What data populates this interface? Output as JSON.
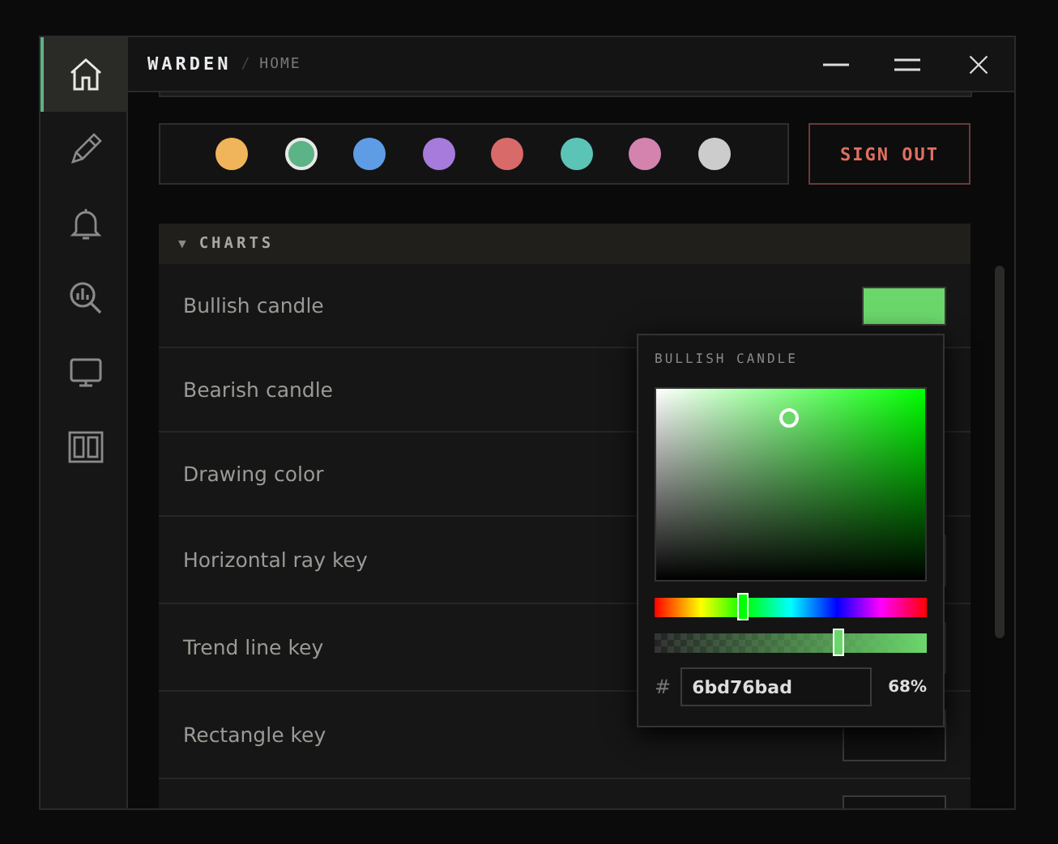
{
  "window": {
    "brand": "WARDEN",
    "separator": "/",
    "breadcrumb": "HOME"
  },
  "sidebar": {
    "items": [
      {
        "selected": true
      },
      {
        "selected": false
      },
      {
        "selected": false
      },
      {
        "selected": false
      },
      {
        "selected": false
      },
      {
        "selected": false
      }
    ]
  },
  "theme_swatches": [
    {
      "color": "#f0b45a",
      "selected": false
    },
    {
      "color": "#5bb386",
      "selected": true
    },
    {
      "color": "#5e9de6",
      "selected": false
    },
    {
      "color": "#a67bdc",
      "selected": false
    },
    {
      "color": "#d86a6a",
      "selected": false
    },
    {
      "color": "#5bc4b6",
      "selected": false
    },
    {
      "color": "#d482ae",
      "selected": false
    },
    {
      "color": "#cccccc",
      "selected": false
    }
  ],
  "sign_out": "SIGN OUT",
  "section": {
    "caret": "▼",
    "title": "CHARTS",
    "expanded": true,
    "rows": [
      {
        "label": "Bullish candle",
        "kind": "color",
        "color": "#6bd76b"
      },
      {
        "label": "Bearish candle",
        "kind": "color"
      },
      {
        "label": "Drawing color",
        "kind": "color"
      },
      {
        "label": "Horizontal ray key",
        "kind": "key"
      },
      {
        "label": "Trend line key",
        "kind": "key"
      },
      {
        "label": "Rectangle key",
        "kind": "key"
      },
      {
        "kind": "key"
      }
    ]
  },
  "picker": {
    "title": "BULLISH CANDLE",
    "hue": {
      "level": 0.33
    },
    "alpha": {
      "level": 0.68
    },
    "hash": "#",
    "hex": "6bd76bad",
    "percent": "68%"
  }
}
